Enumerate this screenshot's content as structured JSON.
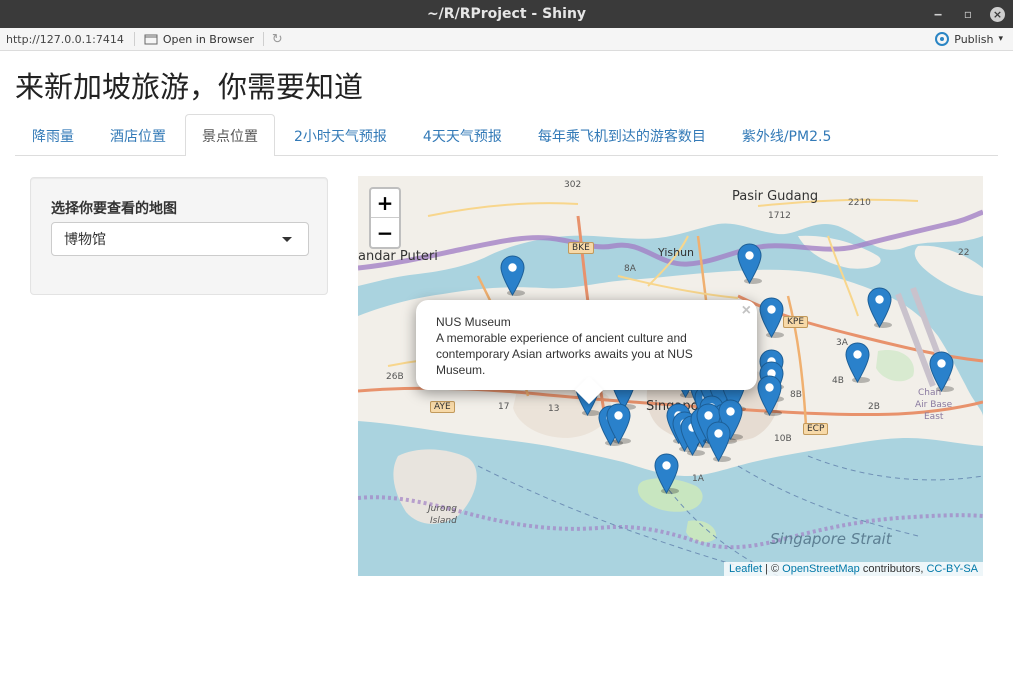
{
  "window": {
    "title": "~/R/RProject - Shiny",
    "minimize_glyph": "‒",
    "maximize_glyph": "▫",
    "close_glyph": "×"
  },
  "toolbar": {
    "url": "http://127.0.0.1:7414",
    "open_in_browser": "Open in Browser",
    "publish": "Publish",
    "publish_caret": "▾",
    "refresh_glyph": "↻"
  },
  "page": {
    "title": "来新加坡旅游，你需要知道"
  },
  "tabs": [
    {
      "label": "降雨量",
      "active": false
    },
    {
      "label": "酒店位置",
      "active": false
    },
    {
      "label": "景点位置",
      "active": true
    },
    {
      "label": "2小时天气预报",
      "active": false
    },
    {
      "label": "4天天气预报",
      "active": false
    },
    {
      "label": "每年乘飞机到达的游客数目",
      "active": false
    },
    {
      "label": "紫外线/PM2.5",
      "active": false
    }
  ],
  "sidebar": {
    "label": "选择你要查看的地图",
    "selected": "博物馆"
  },
  "map": {
    "zoom_in": "+",
    "zoom_out": "−",
    "labels": {
      "pasir_gudang": "Pasir Gudang",
      "yishun": "Yishun",
      "bandar_puteri": "andar Puteri",
      "singapore": "Singapore",
      "jurong_island_1": "Jurong",
      "jurong_island_2": "Island",
      "singapore_strait": "Singapore Strait",
      "changi_1": "Chan",
      "changi_2": "Air Base",
      "changi_3": "East",
      "road_302": "302",
      "road_1712": "1712",
      "road_2210": "2210",
      "road_2210b": "22",
      "road_26b": "26B",
      "road_13": "13",
      "road_17": "17",
      "road_10b": "10B",
      "road_8b": "8B",
      "road_4b": "4B",
      "road_2b": "2B",
      "road_3a": "3A",
      "road_1a": "1A",
      "road_8a": "8A"
    },
    "shields": {
      "bke": "BKE",
      "kpe": "KPE",
      "aye": "AYE",
      "ecp": "ECP"
    },
    "attribution": {
      "leaflet": "Leaflet",
      "sep": " | © ",
      "osm": "OpenStreetMap",
      "contrib": " contributors, ",
      "license": "CC-BY-SA"
    },
    "popup": {
      "title": "NUS Museum",
      "description": "A memorable experience of ancient culture and contemporary Asian artworks awaits you at NUS Museum.",
      "close": "×"
    },
    "colors": {
      "water": "#aad3df",
      "land": "#f2efe9",
      "marker": "#2a81cb"
    }
  }
}
